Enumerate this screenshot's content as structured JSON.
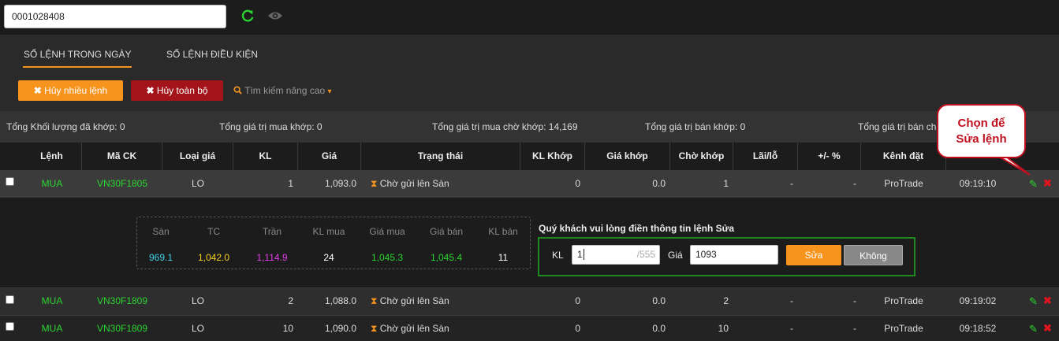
{
  "account": {
    "value": "0001028408"
  },
  "tabs": [
    {
      "label": "SỔ LỆNH TRONG NGÀY",
      "active": true
    },
    {
      "label": "SỔ LỆNH ĐIỀU KIỆN",
      "active": false
    }
  ],
  "toolbar": {
    "cancel_multi_label": "Hủy nhiều lệnh",
    "cancel_all_label": "Hủy toàn bộ",
    "advanced_search_label": "Tìm kiếm nâng cao"
  },
  "summary": [
    "Tổng Khối lượng đã khớp: 0",
    "Tổng giá trị mua khớp: 0",
    "Tổng giá trị mua chờ khớp: 14,169",
    "Tổng giá trị bán khớp: 0",
    "Tổng giá trị bán chờ"
  ],
  "columns": [
    "Lệnh",
    "Mã CK",
    "Loại giá",
    "KL",
    "Giá",
    "Trạng thái",
    "KL Khớp",
    "Giá khớp",
    "Chờ khớp",
    "Lãi/lỗ",
    "+/- %",
    "Kênh đặt",
    ""
  ],
  "rows": [
    {
      "side": "MUA",
      "symbol": "VN30F1805",
      "price_type": "LO",
      "qty": "1",
      "price": "1,093.0",
      "status": "Chờ gửi lên Sàn",
      "matched_qty": "0",
      "matched_price": "0.0",
      "pending": "1",
      "pnl": "-",
      "pct": "-",
      "channel": "ProTrade",
      "time": "09:19:10"
    },
    {
      "side": "MUA",
      "symbol": "VN30F1809",
      "price_type": "LO",
      "qty": "2",
      "price": "1,088.0",
      "status": "Chờ gửi lên Sàn",
      "matched_qty": "0",
      "matched_price": "0.0",
      "pending": "2",
      "pnl": "-",
      "pct": "-",
      "channel": "ProTrade",
      "time": "09:19:02"
    },
    {
      "side": "MUA",
      "symbol": "VN30F1809",
      "price_type": "LO",
      "qty": "10",
      "price": "1,090.0",
      "status": "Chờ gửi lên Sàn",
      "matched_qty": "0",
      "matched_price": "0.0",
      "pending": "10",
      "pnl": "-",
      "pct": "-",
      "channel": "ProTrade",
      "time": "09:18:52"
    }
  ],
  "quote": {
    "labels": [
      "Sàn",
      "TC",
      "Trần",
      "KL mua",
      "Giá mua",
      "Giá bán",
      "KL bán"
    ],
    "values": [
      "969.1",
      "1,042.0",
      "1,114.9",
      "24",
      "1,045.3",
      "1,045.4",
      "11"
    ],
    "colors": [
      "#3fd0e6",
      "#f5d020",
      "#e040e8",
      "#ffffff",
      "#2bd430",
      "#2bd430",
      "#ffffff"
    ]
  },
  "edit_form": {
    "title": "Quý khách vui lòng điền thông tin lệnh Sửa",
    "qty_label": "KL",
    "qty_value": "1",
    "qty_max": "/555",
    "price_label": "Giá",
    "price_value": "1093",
    "submit_label": "Sửa",
    "cancel_label": "Không"
  },
  "callout": {
    "line1": "Chọn để",
    "line2": "Sửa lệnh"
  },
  "colors": {
    "accent": "#f7941d",
    "danger": "#a3141a",
    "buy": "#2bd430",
    "callout": "#c0101f"
  }
}
